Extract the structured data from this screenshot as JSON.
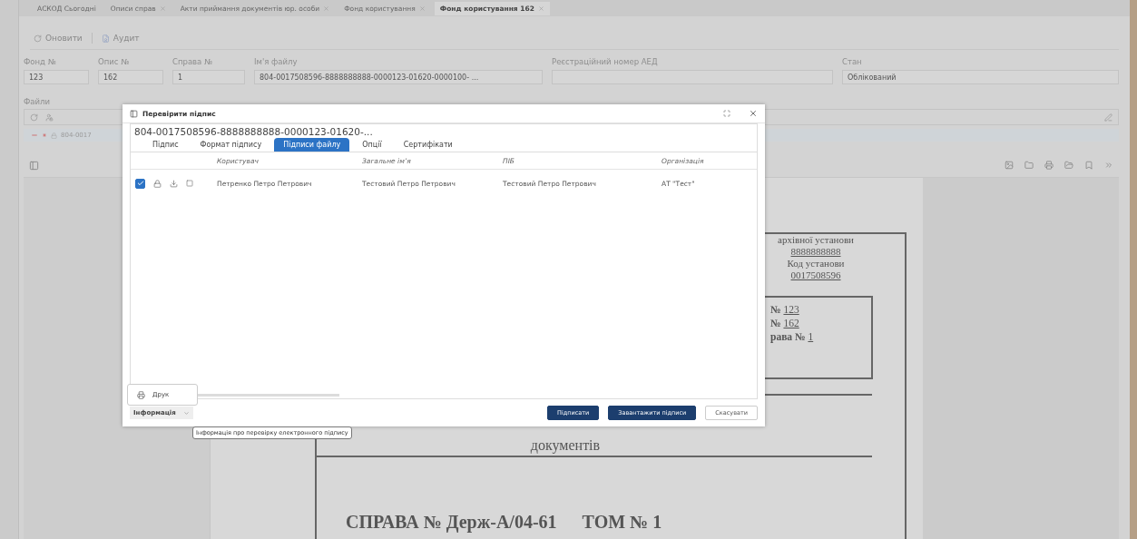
{
  "tabs": [
    {
      "label": "АСКОД Сьогодні",
      "closable": false,
      "selected": false
    },
    {
      "label": "Описи справ",
      "closable": true,
      "selected": false
    },
    {
      "label": "Акти приймання документів юр. особи",
      "closable": true,
      "selected": false
    },
    {
      "label": "Фонд користування",
      "closable": true,
      "selected": false
    },
    {
      "label": "Фонд користування 162",
      "closable": true,
      "selected": true
    }
  ],
  "toolbar": [
    {
      "label": "Оновити",
      "kind": "refresh"
    },
    {
      "label": "Аудит",
      "kind": "audit"
    }
  ],
  "fields": [
    {
      "label": "Фонд №",
      "value": "123"
    },
    {
      "label": "Опис №",
      "value": "162"
    },
    {
      "label": "Справа №",
      "value": "1"
    },
    {
      "label": "Ім'я файлу",
      "value": "804-0017508596-8888888888-0000123-01620-0000100- ..."
    },
    {
      "label": "Реєстраційний номер АЕД"
    },
    {
      "label": "Стан",
      "value": "Облікований"
    }
  ],
  "files": {
    "label": "Файли",
    "tree_row": {
      "name": "804-0017"
    }
  },
  "document": {
    "info_lines": [
      {
        "text": "архівної установи",
        "kind": "plain"
      },
      {
        "text": "8888888888",
        "kind": "underlined"
      },
      {
        "text": "Код установи",
        "kind": "plain"
      },
      {
        "text": "0017508596",
        "kind": "underlined"
      }
    ],
    "box_lines": [
      {
        "prefix": "№",
        "value": "123"
      },
      {
        "prefix": "№",
        "value": "162"
      },
      {
        "prefix": "рава №",
        "value": "1"
      }
    ],
    "subtitle": "документів",
    "case_title": "СПРАВА № Держ-А/04-61",
    "volume": "ТОМ № 1"
  },
  "dialog": {
    "title": "Перевірити підпис",
    "file_name": "804-0017508596-8888888888-0000123-01620-...",
    "tabs": [
      {
        "label": "Підпис",
        "selected": false
      },
      {
        "label": "Формат підпису",
        "selected": false
      },
      {
        "label": "Підписи файлу",
        "selected": true
      },
      {
        "label": "Опції",
        "selected": false
      },
      {
        "label": "Сертифікати",
        "selected": false
      }
    ],
    "columns": [
      "Користувач",
      "Загальне ім’я",
      "ПІБ",
      "Організація"
    ],
    "rows": [
      {
        "checked": true,
        "cells": [
          "Петренко Петро Петрович",
          "Тестовий Петро Петрович",
          "Тестовий Петро Петрович",
          "АТ \"Тест\""
        ]
      }
    ],
    "menu": [
      {
        "label": "Друк"
      }
    ],
    "info_button": "Інформація",
    "buttons": [
      {
        "label": "Підписати",
        "kind": "primary"
      },
      {
        "label": "Завантажити підписи",
        "kind": "primary"
      },
      {
        "label": "Скасувати",
        "kind": "secondary"
      }
    ],
    "tooltip": "Інформація про перевірку електронного підпису"
  }
}
